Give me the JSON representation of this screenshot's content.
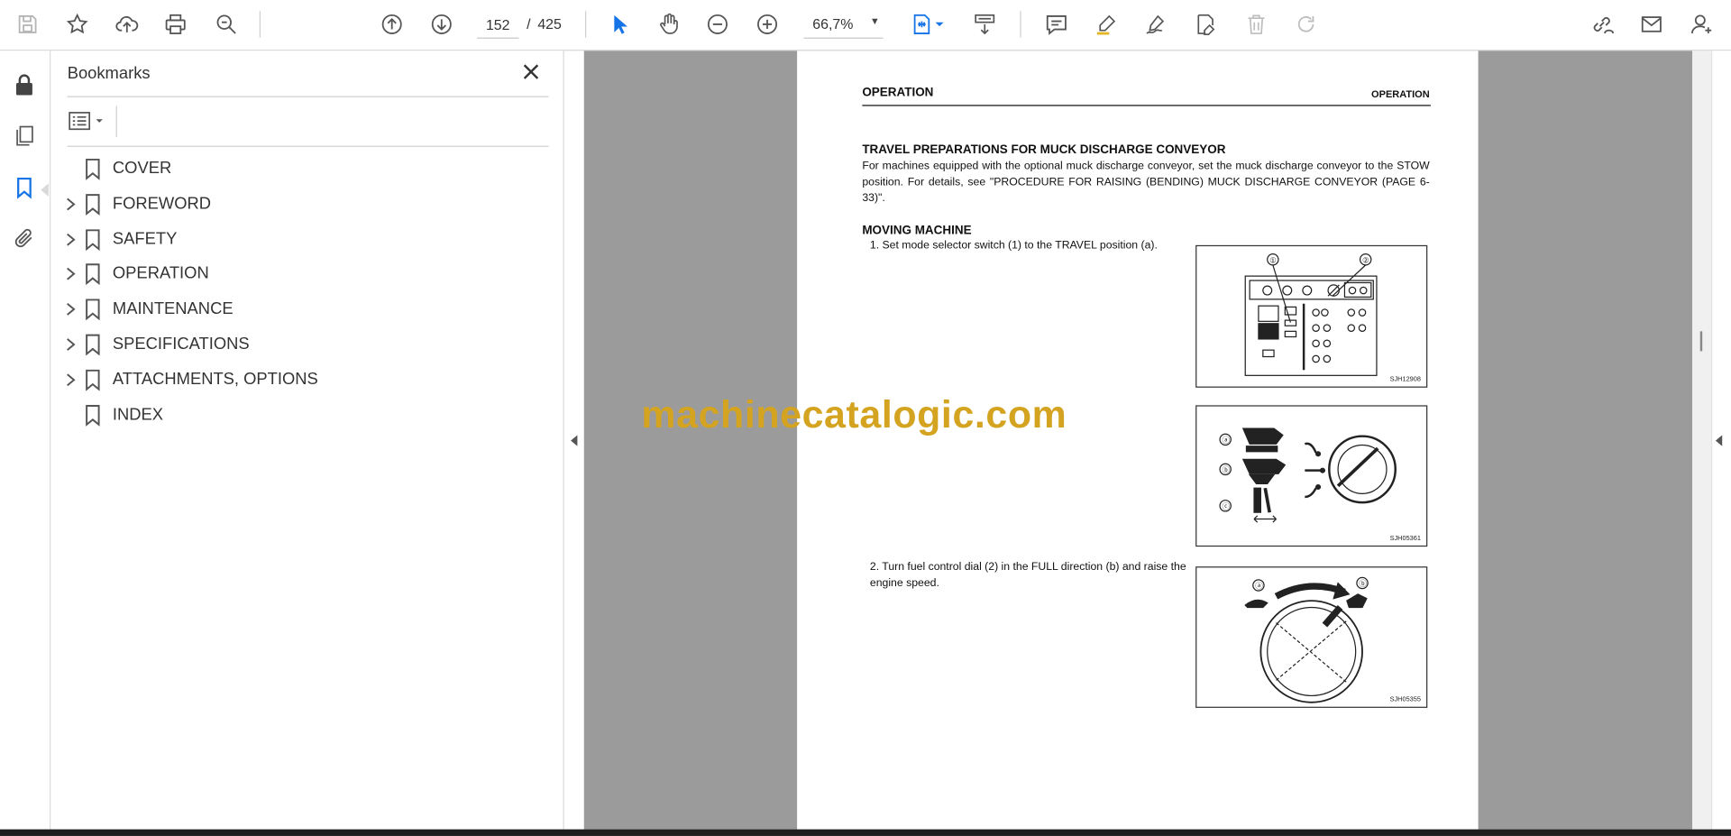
{
  "toolbar": {
    "page_current": "152",
    "page_separator": "/",
    "page_total": "425",
    "zoom": "66,7%"
  },
  "bookmarks": {
    "title": "Bookmarks",
    "items": [
      {
        "label": "COVER",
        "expandable": false
      },
      {
        "label": "FOREWORD",
        "expandable": true
      },
      {
        "label": "SAFETY",
        "expandable": true
      },
      {
        "label": "OPERATION",
        "expandable": true
      },
      {
        "label": "MAINTENANCE",
        "expandable": true
      },
      {
        "label": "SPECIFICATIONS",
        "expandable": true
      },
      {
        "label": "ATTACHMENTS, OPTIONS",
        "expandable": true
      },
      {
        "label": "INDEX",
        "expandable": false
      }
    ]
  },
  "document": {
    "header_left": "OPERATION",
    "header_right": "OPERATION",
    "section1_title": "TRAVEL PREPARATIONS FOR MUCK DISCHARGE CONVEYOR",
    "section1_text": "For machines equipped with the optional muck discharge conveyor, set the muck discharge conveyor to the STOW position.  For details, see \"PROCEDURE FOR RAISING (BENDING) MUCK DISCHARGE CONVEYOR (PAGE 6-33)\".",
    "section2_title": "MOVING MACHINE",
    "step1": "1. Set mode selector switch (1) to the TRAVEL position (a).",
    "step2": "2. Turn fuel control dial (2) in the FULL direction (b) and raise the engine speed.",
    "figures": [
      {
        "code": "SJH12908",
        "callouts": [
          "①",
          "②"
        ]
      },
      {
        "code": "SJH05361",
        "callouts": [
          "ⓐ",
          "ⓑ",
          "ⓒ"
        ]
      },
      {
        "code": "SJH05355",
        "callouts": [
          "ⓐ",
          "ⓑ"
        ]
      }
    ]
  },
  "watermark": "machinecatalogic.com",
  "colors": {
    "accent": "#1473e6",
    "doc_background": "#9b9b9b",
    "watermark": "#d4a421"
  },
  "icons": {
    "toolbar": [
      "save-icon",
      "bookmark-star-icon",
      "upload-cloud-icon",
      "print-icon",
      "search-zoom-icon",
      "page-up-icon",
      "page-down-icon",
      "select-cursor-icon",
      "hand-icon",
      "zoom-out-icon",
      "zoom-in-icon",
      "fit-page-icon",
      "scroll-mode-icon",
      "comment-icon",
      "highlight-icon",
      "sign-icon",
      "edit-pdf-icon",
      "delete-icon",
      "redo-icon",
      "share-link-icon",
      "email-icon",
      "account-icon"
    ],
    "rail": [
      "lock-icon",
      "pages-icon",
      "bookmark-icon",
      "attachment-icon"
    ]
  }
}
